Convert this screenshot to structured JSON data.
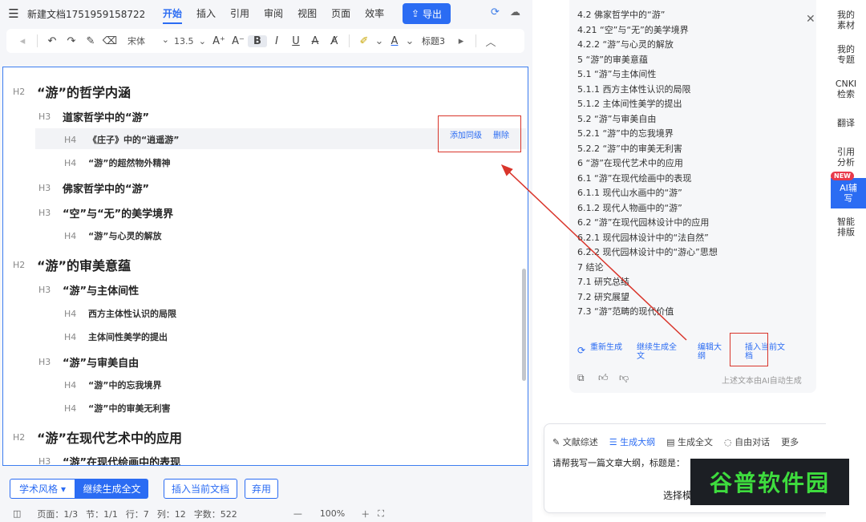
{
  "window": {
    "doc_title": "新建文档1751959158722",
    "export_label": "导出"
  },
  "menu_tabs": [
    "开始",
    "插入",
    "引用",
    "审阅",
    "视图",
    "页面",
    "效率"
  ],
  "active_tab": "开始",
  "toolbar": {
    "font": "宋体",
    "size": "13.5",
    "heading": "标题3"
  },
  "outline_editor": [
    {
      "level": "H2",
      "text": "“游”的哲学内涵"
    },
    {
      "level": "H3",
      "text": "道家哲学中的“游”"
    },
    {
      "level": "H4",
      "text": "《庄子》中的“逍遥游”"
    },
    {
      "level": "H4",
      "text": "“游”的超然物外精神"
    },
    {
      "level": "H3",
      "text": "佛家哲学中的“游”"
    },
    {
      "level": "H3",
      "text": "“空”与“无”的美学境界"
    },
    {
      "level": "H4",
      "text": "“游”与心灵的解放"
    },
    {
      "level": "H2",
      "text": "“游”的审美意蕴"
    },
    {
      "level": "H3",
      "text": "“游”与主体间性"
    },
    {
      "level": "H4",
      "text": "西方主体性认识的局限"
    },
    {
      "level": "H4",
      "text": "主体间性美学的提出"
    },
    {
      "level": "H3",
      "text": "“游”与审美自由"
    },
    {
      "level": "H4",
      "text": "“游”中的忘我境界"
    },
    {
      "level": "H4",
      "text": "“游”中的审美无利害"
    },
    {
      "level": "H2",
      "text": "“游”在现代艺术中的应用"
    },
    {
      "level": "H3",
      "text": "“游”在现代绘画中的表现"
    }
  ],
  "row_actions": {
    "add_sibling": "添加同级",
    "delete": "删除"
  },
  "bottom_actions": {
    "style": "学术风格",
    "continue": "继续生成全文",
    "insert": "插入当前文档",
    "discard": "弃用"
  },
  "statusbar": {
    "page": "页面：1/3",
    "section": "节：1/1",
    "line": "行：7",
    "col": "列：12",
    "words": "字数：522",
    "zoom": "100%"
  },
  "outline_panel": [
    "4.2 佛家哲学中的“游”",
    "4.21 “空”与“无”的美学境界",
    "4.2.2 “游”与心灵的解放",
    "5 “游”的审美意蕴",
    "5.1 “游”与主体间性",
    "5.1.1 西方主体性认识的局限",
    "5.1.2 主体间性美学的提出",
    "5.2 “游”与审美自由",
    "5.2.1 “游”中的忘我境界",
    "5.2.2 “游”中的审美无利害",
    "6 “游”在现代艺术中的应用",
    "6.1 “游”在现代绘画中的表现",
    "6.1.1 现代山水画中的“游”",
    "6.1.2 现代人物画中的“游”",
    "6.2 “游”在现代园林设计中的应用",
    "6.2.1 现代园林设计中的“法自然”",
    "6.2.2 现代园林设计中的“游心”思想",
    "7 结论",
    "7.1 研究总结",
    "7.2 研究展望",
    "7.3 “游”范畴的现代价值"
  ],
  "card_actions": {
    "regenerate": "重新生成",
    "continue_full": "继续生成全文",
    "edit_outline": "编辑大纲",
    "insert_doc": "插入当前文档",
    "ai_note": "上述文本由AI自动生成"
  },
  "chat": {
    "tabs": [
      "文献综述",
      "生成大纲",
      "生成全文",
      "自由对话",
      "更多"
    ],
    "active": "生成大纲",
    "prompt": "请帮我写一篇文章大纲，标题是：",
    "select": "选择模"
  },
  "sidebar": [
    "我的素材",
    "我的专题",
    "CNKI检索",
    "翻译",
    "引用分析",
    "AI辅写",
    "智能排版"
  ],
  "sidebar_badge": "NEW",
  "watermark": "谷普软件园"
}
